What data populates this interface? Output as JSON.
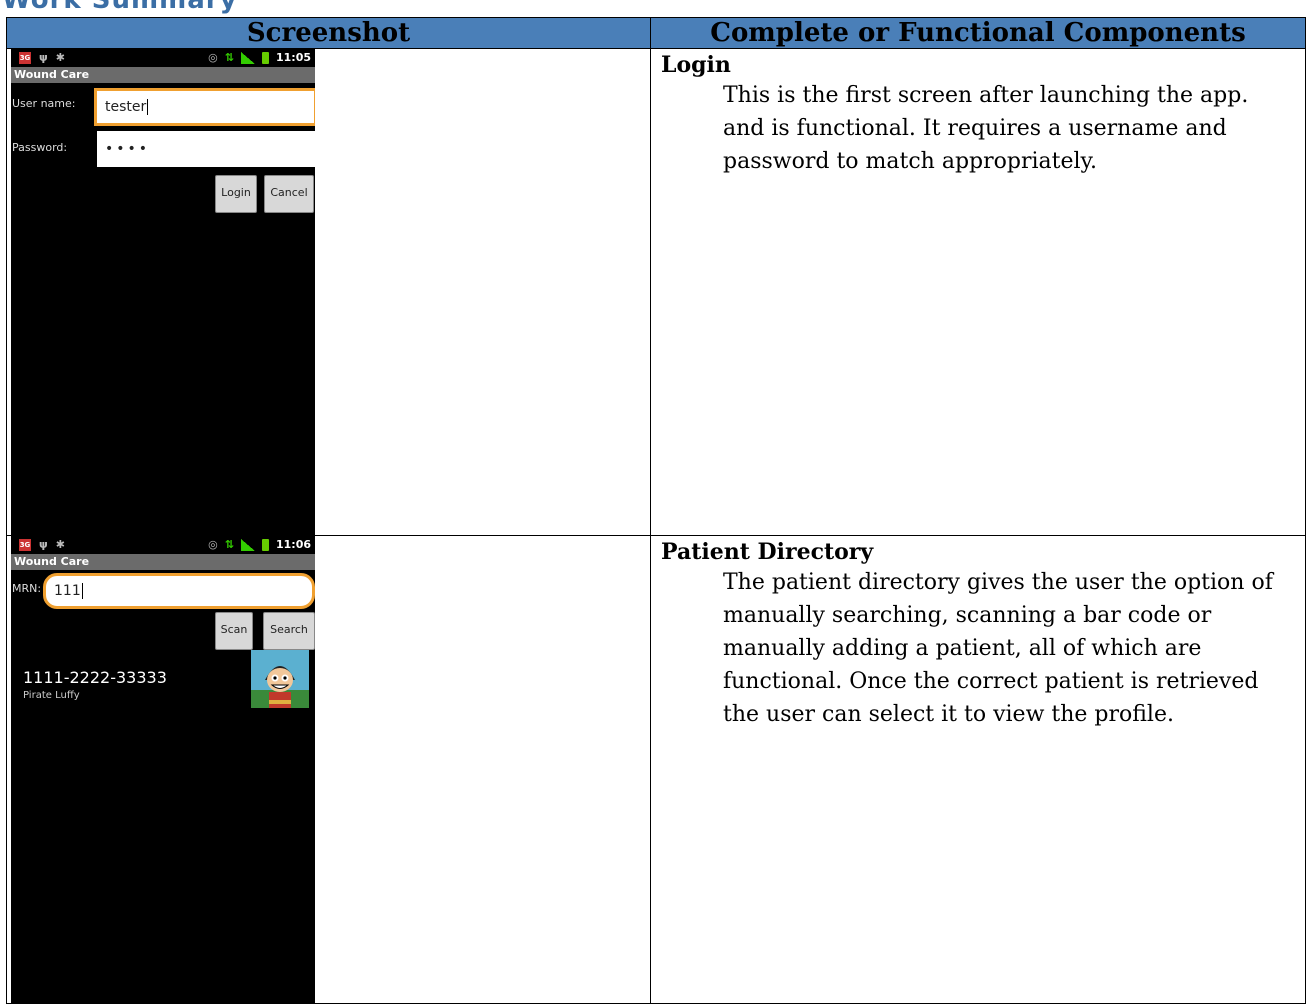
{
  "page": {
    "heading": "Work Summary"
  },
  "table": {
    "col_screenshot": "Screenshot",
    "col_components": "Complete or Functional Components"
  },
  "rows": [
    {
      "title": "Login",
      "description": "This is the first screen after launching the app. and is functional. It requires a username and password to match appropriately.",
      "phone": {
        "time": "11:05",
        "app_title": "Wound Care",
        "username_label": "User name:",
        "username_value": "tester",
        "password_label": "Password:",
        "password_value": "••••",
        "login_button": "Login",
        "cancel_button": "Cancel"
      }
    },
    {
      "title": "Patient Directory",
      "description": "The patient directory gives the user the option of manually searching, scanning a bar code or manually adding a patient, all of which are functional. Once the correct patient is retrieved the user can select it to view the profile.",
      "phone": {
        "time": "11:06",
        "app_title": "Wound Care",
        "mrn_label": "MRN:",
        "mrn_value": "111",
        "scan_button": "Scan",
        "search_button": "Search",
        "patient_mrn": "1111-2222-33333",
        "patient_name": "Pirate Luffy"
      }
    }
  ]
}
